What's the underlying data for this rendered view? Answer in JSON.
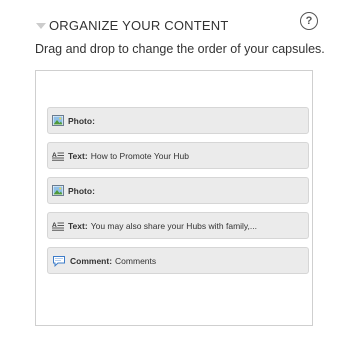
{
  "header": {
    "title": "ORGANIZE YOUR CONTENT",
    "help_icon": "question-circle-icon",
    "help_symbol": "?"
  },
  "instructions": "Drag and drop to change the order of your capsules.",
  "capsules": [
    {
      "icon": "photo-icon",
      "type": "Photo",
      "sep": ":",
      "title": ""
    },
    {
      "icon": "text-icon",
      "type": "Text",
      "sep": ":",
      "title": "How to Promote Your Hub"
    },
    {
      "icon": "photo-icon",
      "type": "Photo",
      "sep": ":",
      "title": ""
    },
    {
      "icon": "text-icon",
      "type": "Text",
      "sep": ":",
      "title": "You may also share your Hubs with family,..."
    },
    {
      "icon": "comment-icon",
      "type": "Comment",
      "sep": ":",
      "title": "Comments"
    }
  ],
  "colors": {
    "capsule_bg": "#ebebeb",
    "capsule_border": "#d6d6d6",
    "panel_border": "#cfcfcf",
    "text": "#333333"
  }
}
